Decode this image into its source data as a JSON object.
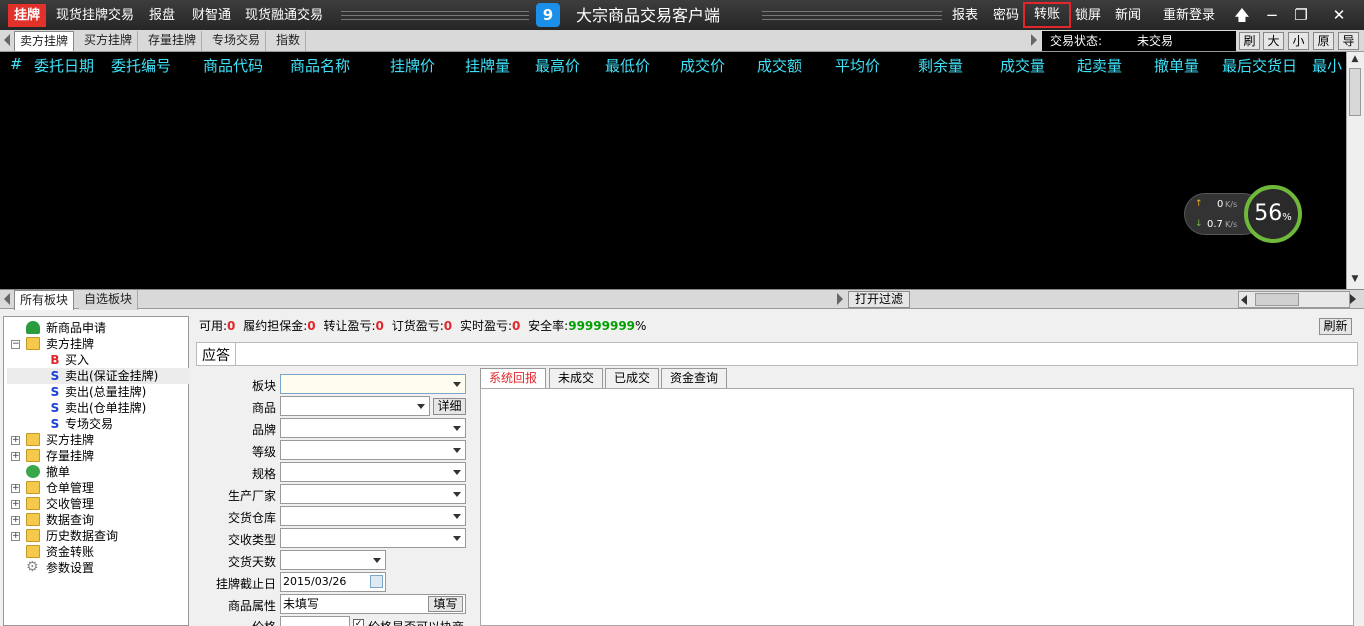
{
  "menu": {
    "active": "挂牌",
    "items": [
      "现货挂牌交易",
      "报盘",
      "财智通",
      "现货融通交易"
    ],
    "right": [
      "报表",
      "密码",
      "转账",
      "锁屏",
      "新闻",
      "重新登录"
    ]
  },
  "app": {
    "icon": "9",
    "title": "大宗商品交易客户端"
  },
  "window": {
    "pin": "🡅",
    "min": "−",
    "restore": "❐",
    "close": "✕"
  },
  "tabs": [
    "卖方挂牌",
    "买方挂牌",
    "存量挂牌",
    "专场交易",
    "指数"
  ],
  "trade_status": {
    "label": "交易状态:",
    "value": "未交易"
  },
  "font_buttons": [
    "刷",
    "大",
    "小",
    "原",
    "导"
  ],
  "grid": {
    "columns": [
      "#",
      "委托日期",
      "委托编号",
      "商品代码",
      "商品名称",
      "挂牌价",
      "挂牌量",
      "最高价",
      "最低价",
      "成交价",
      "成交额",
      "平均价",
      "剩余量",
      "成交量",
      "起卖量",
      "撤单量",
      "最后交货日",
      "最小"
    ]
  },
  "speed": {
    "up": "0",
    "up_unit": "K/s",
    "down": "0.7",
    "down_unit": "K/s",
    "percent": "56",
    "percent_sign": "%"
  },
  "block_tabs": [
    "所有板块",
    "自选板块"
  ],
  "filter_button": "打开过滤",
  "tree": [
    {
      "label": "新商品申请",
      "icon": "person-icon",
      "level": 1
    },
    {
      "label": "卖方挂牌",
      "icon": "folder-open-icon",
      "level": 0,
      "expand": "−"
    },
    {
      "label": "买入",
      "icon": "buy-icon",
      "letter": "B",
      "level": 2
    },
    {
      "label": "卖出(保证金挂牌)",
      "icon": "sell-icon",
      "letter": "S",
      "level": 2
    },
    {
      "label": "卖出(总量挂牌)",
      "icon": "sell-icon",
      "letter": "S",
      "level": 2
    },
    {
      "label": "卖出(仓单挂牌)",
      "icon": "sell-icon",
      "letter": "S",
      "level": 2
    },
    {
      "label": "专场交易",
      "icon": "sell-icon",
      "letter": "S",
      "level": 2
    },
    {
      "label": "买方挂牌",
      "icon": "folder-icon",
      "level": 0,
      "expand": "+"
    },
    {
      "label": "存量挂牌",
      "icon": "folder-icon",
      "level": 0,
      "expand": "+"
    },
    {
      "label": "撤单",
      "icon": "cancel-icon",
      "level": 1
    },
    {
      "label": "仓单管理",
      "icon": "folder-icon",
      "level": 0,
      "expand": "+"
    },
    {
      "label": "交收管理",
      "icon": "folder-icon",
      "level": 0,
      "expand": "+"
    },
    {
      "label": "数据查询",
      "icon": "folder-icon",
      "level": 0,
      "expand": "+"
    },
    {
      "label": "历史数据查询",
      "icon": "folder-icon",
      "level": 0,
      "expand": "+"
    },
    {
      "label": "资金转账",
      "icon": "folder-icon",
      "level": 1
    },
    {
      "label": "参数设置",
      "icon": "gear-icon",
      "level": 1
    }
  ],
  "info": {
    "available_label": "可用:",
    "available": "0",
    "margin_label": "履约担保金:",
    "margin": "0",
    "transfer_label": "转让盈亏:",
    "transfer": "0",
    "order_label": "订货盈亏:",
    "order": "0",
    "realtime_label": "实时盈亏:",
    "realtime": "0",
    "safety_label": "安全率:",
    "safety": "99999999",
    "safety_unit": "%"
  },
  "refresh_button": "刷新",
  "response_label": "应答",
  "form": {
    "board": "板块",
    "commodity": "商品",
    "detail": "详细",
    "brand": "品牌",
    "grade": "等级",
    "spec": "规格",
    "manufacturer": "生产厂家",
    "warehouse": "交货仓库",
    "delivery_type": "交收类型",
    "delivery_days": "交货天数",
    "deadline_label": "挂牌截止日",
    "deadline": "2015/03/26",
    "attr_label": "商品属性",
    "attr_value": "未填写",
    "fill_button": "填写",
    "price_label": "价格",
    "negotiable": "价格是否可以协商"
  },
  "result_tabs": [
    "系统回报",
    "未成交",
    "已成交",
    "资金查询"
  ]
}
